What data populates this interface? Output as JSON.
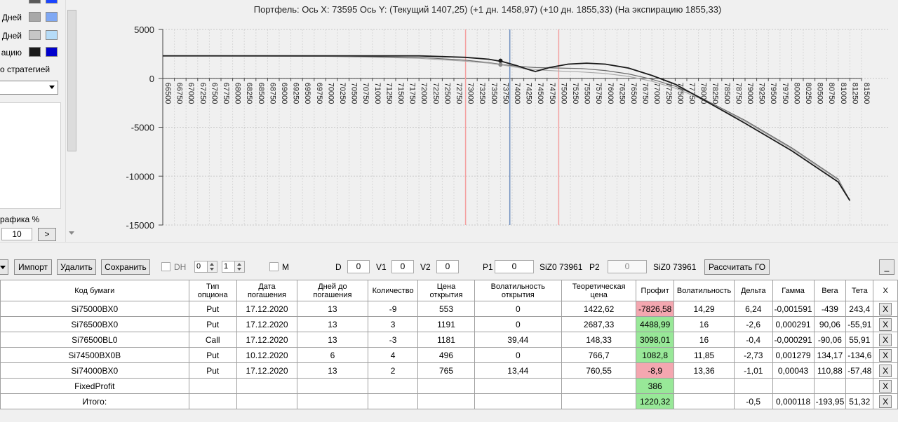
{
  "left_panel": {
    "legend": [
      {
        "label": "",
        "color_a": "#5a5a5a",
        "color_b": "#1a44ff"
      },
      {
        "label": "Дней",
        "color_a": "#a8a8a8",
        "color_b": "#7fa8f4"
      },
      {
        "label": "Дней",
        "color_a": "#c6c6c6",
        "color_b": "#b6dcf8"
      },
      {
        "label": "ацию",
        "color_a": "#1a1a1a",
        "color_b": "#0000cc"
      }
    ],
    "strategy_label": "о стратегией",
    "graph_scale_label": "рафика %",
    "scale_value": "10",
    "scale_button": ">"
  },
  "chart": {
    "title": "Портфель: Ось X: 73595 Ось Y:  (Текущий 1407,25)  (+1 дн. 1458,97)  (+10 дн. 1855,33)  (На экспирацию 1855,33)"
  },
  "chart_data": {
    "type": "line",
    "x_ticks": [
      66500,
      66750,
      67000,
      67250,
      67500,
      67750,
      68000,
      68250,
      68500,
      68750,
      69000,
      69250,
      69500,
      69750,
      70000,
      70250,
      70500,
      70750,
      71000,
      71250,
      71500,
      71750,
      72000,
      72250,
      72500,
      72750,
      73000,
      73250,
      73500,
      73750,
      74000,
      74250,
      74500,
      74750,
      75000,
      75250,
      75500,
      75750,
      76000,
      76250,
      76500,
      76750,
      77000,
      77250,
      77500,
      77750,
      78000,
      78250,
      78500,
      78750,
      79000,
      79250,
      79500,
      79750,
      80000,
      80250,
      80500,
      80750,
      81000,
      81250,
      81500
    ],
    "y_ticks": [
      5000,
      0,
      -5000,
      -10000,
      -15000
    ],
    "ylim": [
      -15000,
      5000
    ],
    "xlim": [
      66500,
      81500
    ],
    "grid": true,
    "vertical_markers": [
      {
        "x": 73000,
        "color": "#f4a0a0"
      },
      {
        "x": 73950,
        "color": "#6f8fbf"
      },
      {
        "x": 75000,
        "color": "#f4a0a0"
      }
    ],
    "series": [
      {
        "color": "#1a1a1a",
        "width": 1.8,
        "points": [
          [
            66500,
            2300
          ],
          [
            70000,
            2300
          ],
          [
            72000,
            2300
          ],
          [
            73000,
            2150
          ],
          [
            73500,
            1950
          ],
          [
            73800,
            1700
          ],
          [
            74100,
            1300
          ],
          [
            74350,
            900
          ],
          [
            74500,
            700
          ],
          [
            74800,
            1100
          ],
          [
            75200,
            1450
          ],
          [
            75600,
            1550
          ],
          [
            76000,
            1450
          ],
          [
            76500,
            1050
          ],
          [
            77000,
            300
          ],
          [
            77500,
            -600
          ],
          [
            78000,
            -1900
          ],
          [
            79000,
            -4600
          ],
          [
            80000,
            -7400
          ],
          [
            81000,
            -10600
          ],
          [
            81250,
            -12500
          ]
        ]
      },
      {
        "color": "#a8a8a8",
        "width": 1.2,
        "points": [
          [
            66500,
            2300
          ],
          [
            70000,
            2250
          ],
          [
            72000,
            2050
          ],
          [
            73000,
            1750
          ],
          [
            73500,
            1550
          ],
          [
            73800,
            1350
          ],
          [
            74200,
            1050
          ],
          [
            74600,
            850
          ],
          [
            75000,
            750
          ],
          [
            75500,
            650
          ],
          [
            76000,
            500
          ],
          [
            76500,
            200
          ],
          [
            77000,
            -300
          ],
          [
            77500,
            -1000
          ],
          [
            78000,
            -2000
          ],
          [
            79000,
            -4400
          ],
          [
            80000,
            -7200
          ],
          [
            81000,
            -10400
          ],
          [
            81250,
            -12500
          ]
        ]
      },
      {
        "color": "#6a6a6a",
        "width": 1.2,
        "points": [
          [
            66500,
            2300
          ],
          [
            70000,
            2270
          ],
          [
            72000,
            2150
          ],
          [
            73000,
            1850
          ],
          [
            73500,
            1600
          ],
          [
            73800,
            1400
          ],
          [
            74200,
            1200
          ],
          [
            74500,
            1100
          ],
          [
            75000,
            1050
          ],
          [
            75500,
            1000
          ],
          [
            76000,
            800
          ],
          [
            76500,
            450
          ],
          [
            77000,
            -100
          ],
          [
            77500,
            -800
          ],
          [
            78000,
            -1850
          ],
          [
            79000,
            -4300
          ],
          [
            80000,
            -7100
          ],
          [
            81000,
            -10300
          ],
          [
            81250,
            -12500
          ]
        ]
      }
    ],
    "markers": [
      {
        "x": 73750,
        "y": 1800,
        "color": "#1a1a1a"
      },
      {
        "x": 73750,
        "y": 1400,
        "color": "#888888"
      }
    ]
  },
  "toolbar": {
    "import_label": "Импорт",
    "delete_label": "Удалить",
    "save_label": "Сохранить",
    "dh_label": "DH",
    "spin1_value": "0",
    "spin2_value": "1",
    "m_label": "M",
    "d_label": "D",
    "d_value": "0",
    "v1_label": "V1",
    "v1_value": "0",
    "v2_label": "V2",
    "v2_value": "0",
    "p1_label": "P1",
    "p1_value": "0",
    "si1_label": "SiZ0 73961",
    "p2_label": "P2",
    "p2_value": "0",
    "si2_label": "SiZ0 73961",
    "calc_go_label": "Рассчитать ГО",
    "minimize_label": "_"
  },
  "table": {
    "headers": [
      "Код бумаги",
      "Тип опциона",
      "Дата погашения",
      "Дней до погашения",
      "Количество",
      "Цена открытия",
      "Волатильность открытия",
      "Теоретическая цена",
      "Профит",
      "Волатильность",
      "Дельта",
      "Гамма",
      "Вега",
      "Тета",
      "X"
    ],
    "rows": [
      [
        "Si75000BX0",
        "Put",
        "17.12.2020",
        "13",
        "-9",
        "553",
        "0",
        "1422,62",
        "-7826,58",
        "14,29",
        "6,24",
        "-0,001591",
        "-439",
        "243,4",
        "X"
      ],
      [
        "Si76500BX0",
        "Put",
        "17.12.2020",
        "13",
        "3",
        "1191",
        "0",
        "2687,33",
        "4488,99",
        "16",
        "-2,6",
        "0,000291",
        "90,06",
        "-55,91",
        "X"
      ],
      [
        "Si76500BL0",
        "Call",
        "17.12.2020",
        "13",
        "-3",
        "1181",
        "39,44",
        "148,33",
        "3098,01",
        "16",
        "-0,4",
        "-0,000291",
        "-90,06",
        "55,91",
        "X"
      ],
      [
        "Si74500BX0B",
        "Put",
        "10.12.2020",
        "6",
        "4",
        "496",
        "0",
        "766,7",
        "1082,8",
        "11,85",
        "-2,73",
        "0,001279",
        "134,17",
        "-134,6",
        "X"
      ],
      [
        "Si74000BX0",
        "Put",
        "17.12.2020",
        "13",
        "2",
        "765",
        "13,44",
        "760,55",
        "-8,9",
        "13,36",
        "-1,01",
        "0,00043",
        "110,88",
        "-57,48",
        "X"
      ],
      [
        "FixedProfit",
        "",
        "",
        "",
        "",
        "",
        "",
        "",
        "386",
        "",
        "",
        "",
        "",
        "",
        "X"
      ],
      [
        "Итого:",
        "",
        "",
        "",
        "",
        "",
        "",
        "",
        "1220,32",
        "",
        "-0,5",
        "0,000118",
        "-193,95",
        "51,32",
        "X"
      ]
    ],
    "profit_status": [
      "neg",
      "pos",
      "pos",
      "pos",
      "neg",
      "pos",
      "pos"
    ]
  }
}
